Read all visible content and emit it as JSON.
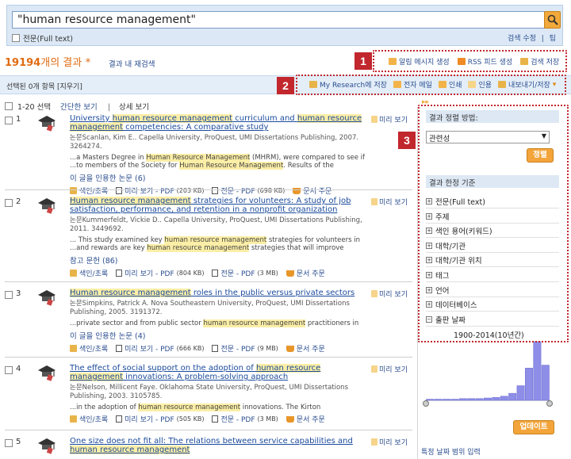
{
  "search": {
    "query": "\"human resource management\"",
    "fulltext_label": "전문(Full text)",
    "links": [
      "검색 수정",
      "|",
      "팁"
    ]
  },
  "results_header": {
    "count": "19194",
    "count_suffix": "개의 결과",
    "star": "*",
    "refine": "결과 내 재검색"
  },
  "alert_bar": {
    "items": [
      "알림 메시지 생성",
      "RSS 피드 생성",
      "검색 저장"
    ],
    "badge": "1"
  },
  "selection_bar": {
    "text": "선택된 0개 항목 [지우기]",
    "tools": [
      "My Research에 저장",
      "전자 메일",
      "인쇄",
      "인용",
      "내보내기/저장"
    ],
    "badge": "2"
  },
  "list_controls": {
    "select_label": "1-20 선택",
    "brief_view": "간단한 보기",
    "separator": "|",
    "detail_view": "상세 보기"
  },
  "results": [
    {
      "number": "1",
      "title_parts": [
        {
          "t": "University ",
          "h": false
        },
        {
          "t": "human resource management",
          "h": true
        },
        {
          "t": " curriculum and ",
          "h": false
        },
        {
          "t": "human resource management",
          "h": true
        },
        {
          "t": " competencies: A comparative study",
          "h": false
        }
      ],
      "meta": "논문Scanlan, Kim E.. Capella University, ProQuest, UMI Dissertations Publishing, 2007. 3264274.",
      "snippet1_parts": [
        {
          "t": "...a Masters Degree in ",
          "h": false
        },
        {
          "t": "Human Resource Management",
          "h": true
        },
        {
          "t": " (MHRM), were compared to see if",
          "h": false
        }
      ],
      "snippet2_parts": [
        {
          "t": "...to members of the Society for ",
          "h": false
        },
        {
          "t": "Human Resource Management",
          "h": true
        },
        {
          "t": ". Results of the",
          "h": false
        }
      ],
      "cite": "이 글을 인용한 논문 (6)",
      "links": [
        "색인/초록",
        "미리 보기 - PDF",
        "(203 KB)",
        "전문 - PDF",
        "(698 KB)",
        "문서 주문"
      ],
      "preview": "미리 보기"
    },
    {
      "number": "2",
      "title_parts": [
        {
          "t": "Human resource management",
          "h": true
        },
        {
          "t": " strategies for volunteers: A study of job satisfaction, performance, and retention in a nonprofit organization",
          "h": false
        }
      ],
      "meta": "논문Kummerfeldt, Vickie D.. Capella University, ProQuest, UMI Dissertations Publishing, 2011. 3449692.",
      "snippet1_parts": [
        {
          "t": "... This study examined key ",
          "h": false
        },
        {
          "t": "human resource management",
          "h": true
        },
        {
          "t": " strategies for volunteers in",
          "h": false
        }
      ],
      "snippet2_parts": [
        {
          "t": "...and rewards are key ",
          "h": false
        },
        {
          "t": "human resource management",
          "h": true
        },
        {
          "t": " strategies that will improve",
          "h": false
        }
      ],
      "cite": "참고 문헌 (86)",
      "links": [
        "색인/초록",
        "미리 보기 - PDF",
        "(804 KB)",
        "전문 - PDF",
        "(3 MB)",
        "문서 주문"
      ],
      "preview": "미리 보기"
    },
    {
      "number": "3",
      "title_parts": [
        {
          "t": "Human resource management",
          "h": true
        },
        {
          "t": " roles in the public versus private sectors",
          "h": false
        }
      ],
      "meta": "논문Simpkins, Patrick A. Nova Southeastern University, ProQuest, UMI Dissertations Publishing, 2005. 3191372.",
      "snippet1_parts": [
        {
          "t": "...private sector and from public sector ",
          "h": false
        },
        {
          "t": "human resource management",
          "h": true
        },
        {
          "t": " practitioners in",
          "h": false
        }
      ],
      "snippet2_parts": [],
      "cite": "이 글을 인용한 논문 (4)",
      "links": [
        "색인/초록",
        "미리 보기 - PDF",
        "(666 KB)",
        "전문 - PDF",
        "(9 MB)",
        "문서 주문"
      ],
      "preview": "미리 보기"
    },
    {
      "number": "4",
      "title_parts": [
        {
          "t": "The effect of social support on the adoption of ",
          "h": false
        },
        {
          "t": "human resource management",
          "h": true
        },
        {
          "t": " innovations: A problem-solving approach",
          "h": false
        }
      ],
      "meta": "논문Nelson, Millicent Faye. Oklahoma State University, ProQuest, UMI Dissertations Publishing, 2003. 3105785.",
      "snippet1_parts": [
        {
          "t": "...in the adoption of ",
          "h": false
        },
        {
          "t": "human resource management",
          "h": true
        },
        {
          "t": " innovations. The Kirton",
          "h": false
        }
      ],
      "snippet2_parts": [],
      "cite": "",
      "links": [
        "색인/초록",
        "미리 보기 - PDF",
        "(505 KB)",
        "전문 - PDF",
        "(3 MB)",
        "문서 주문"
      ],
      "preview": "미리 보기"
    },
    {
      "number": "5",
      "title_parts": [
        {
          "t": "One size does not fit all: The relations between service capabilities and ",
          "h": false
        },
        {
          "t": "human resource management",
          "h": true
        }
      ],
      "meta": "",
      "snippet1_parts": [],
      "snippet2_parts": [],
      "cite": "",
      "links": [],
      "preview": "미리 보기"
    }
  ],
  "right_panel": {
    "collapse": "▸▸",
    "badge": "3",
    "sort_heading": "결과 정렬 방법:",
    "sort_value": "관련성",
    "sort_button": "정렬",
    "limit_heading": "결과 한정 기준",
    "facets": [
      "전문(Full text)",
      "주제",
      "색인 용어(키워드)",
      "대학/기관",
      "대학/기관 위치",
      "태그",
      "언어",
      "데이터베이스",
      "출판 날짜"
    ],
    "date_range": "1900-2014(10년간)",
    "histogram": [
      0.02,
      0.02,
      0.02,
      0.02,
      0.03,
      0.03,
      0.03,
      0.04,
      0.05,
      0.07,
      0.12,
      0.25,
      0.55,
      1.0,
      0.6
    ],
    "update_button": "업데이트",
    "range_link": "특정 날짜 범위 입력"
  },
  "colors": {
    "accent": "#e06b10",
    "link": "#1a4a9c",
    "highlight": "#fbeea6",
    "badge": "#c1272d",
    "button": "#f3a43a",
    "bar": "#8e8ee8"
  }
}
